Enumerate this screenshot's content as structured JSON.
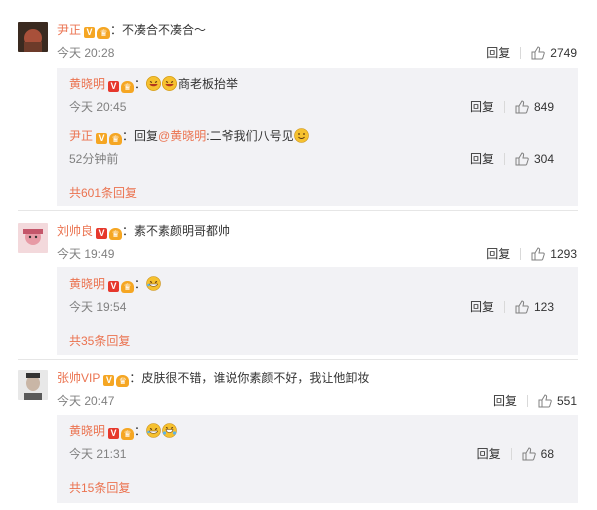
{
  "labels": {
    "reply": "回复"
  },
  "comments": [
    {
      "user": "尹正",
      "text": "不凑合不凑合～",
      "time": "今天 20:28",
      "likes": "2749",
      "replies": [
        {
          "user": "黄晓明",
          "text": "商老板抬举",
          "time": "今天 20:45",
          "likes": "849"
        },
        {
          "user": "尹正",
          "prefix": "回复",
          "mention": "@黄晓明",
          "text": ":二爷我们八号见",
          "time": "52分钟前",
          "likes": "304"
        }
      ],
      "more": "共601条回复"
    },
    {
      "user": "刘帅良",
      "text": "素不素颜明哥都帅",
      "time": "今天 19:49",
      "likes": "1293",
      "replies": [
        {
          "user": "黄晓明",
          "text": "",
          "time": "今天 19:54",
          "likes": "123"
        }
      ],
      "more": "共35条回复"
    },
    {
      "user": "张帅VIP",
      "text": "皮肤很不错，谁说你素颜不好，我让他卸妆",
      "time": "今天 20:47",
      "likes": "551",
      "replies": [
        {
          "user": "黄晓明",
          "text": "",
          "time": "今天 21:31",
          "likes": "68"
        }
      ],
      "more": "共15条回复"
    }
  ],
  "colors": {
    "username": "#eb7350",
    "verified_red": "#e6382c",
    "verified_yellow": "#f5a623",
    "reply_bg": "#f2f2f5",
    "muted": "#808080"
  },
  "icons": [
    "verified-badge-icon",
    "vip-crown-icon",
    "thumbs-up-icon",
    "laughing-emoji-icon",
    "smile-emoji-icon"
  ]
}
